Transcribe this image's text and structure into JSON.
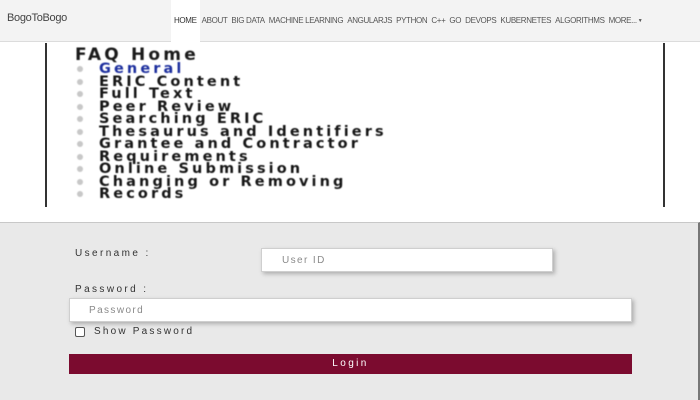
{
  "navbar": {
    "brand": "BogoToBogo",
    "items": [
      {
        "label": "HOME",
        "active": true
      },
      {
        "label": "ABOUT",
        "active": false
      },
      {
        "label": "BIG DATA",
        "active": false
      },
      {
        "label": "MACHINE LEARNING",
        "active": false
      },
      {
        "label": "ANGULARJS",
        "active": false
      },
      {
        "label": "PYTHON",
        "active": false
      },
      {
        "label": "C++",
        "active": false
      },
      {
        "label": "GO",
        "active": false
      },
      {
        "label": "DEVOPS",
        "active": false
      },
      {
        "label": "KUBERNETES",
        "active": false
      },
      {
        "label": "ALGORITHMS",
        "active": false
      },
      {
        "label": "MORE...",
        "active": false,
        "dropdown": true
      }
    ]
  },
  "faq": {
    "title": "FAQ Home",
    "items": [
      {
        "label": "General",
        "link": true
      },
      {
        "label": "ERIC Content",
        "link": false
      },
      {
        "label": "Full Text",
        "link": false
      },
      {
        "label": "Peer Review",
        "link": false
      },
      {
        "label": "Searching ERIC",
        "link": false
      },
      {
        "label": "Thesaurus and Identifiers",
        "link": false
      },
      {
        "label": "Grantee and Contractor",
        "link": false
      },
      {
        "label": "Requirements",
        "link": false
      },
      {
        "label": "Online Submission",
        "link": false
      },
      {
        "label": "Changing or Removing",
        "link": false
      },
      {
        "label": "Records",
        "link": false
      }
    ]
  },
  "login": {
    "username_label": "Username :",
    "username_placeholder": "User ID",
    "username_value": "",
    "password_label": "Password :",
    "password_placeholder": "Password",
    "password_value": "",
    "show_password_label": "Show Password",
    "show_password_checked": false,
    "login_button_label": "Login"
  },
  "colors": {
    "login_button": "#7b0b2f",
    "faq_link": "#1d2f9e",
    "navbar_bg": "#f3f3f3",
    "form_bg": "#e9e9e9"
  }
}
